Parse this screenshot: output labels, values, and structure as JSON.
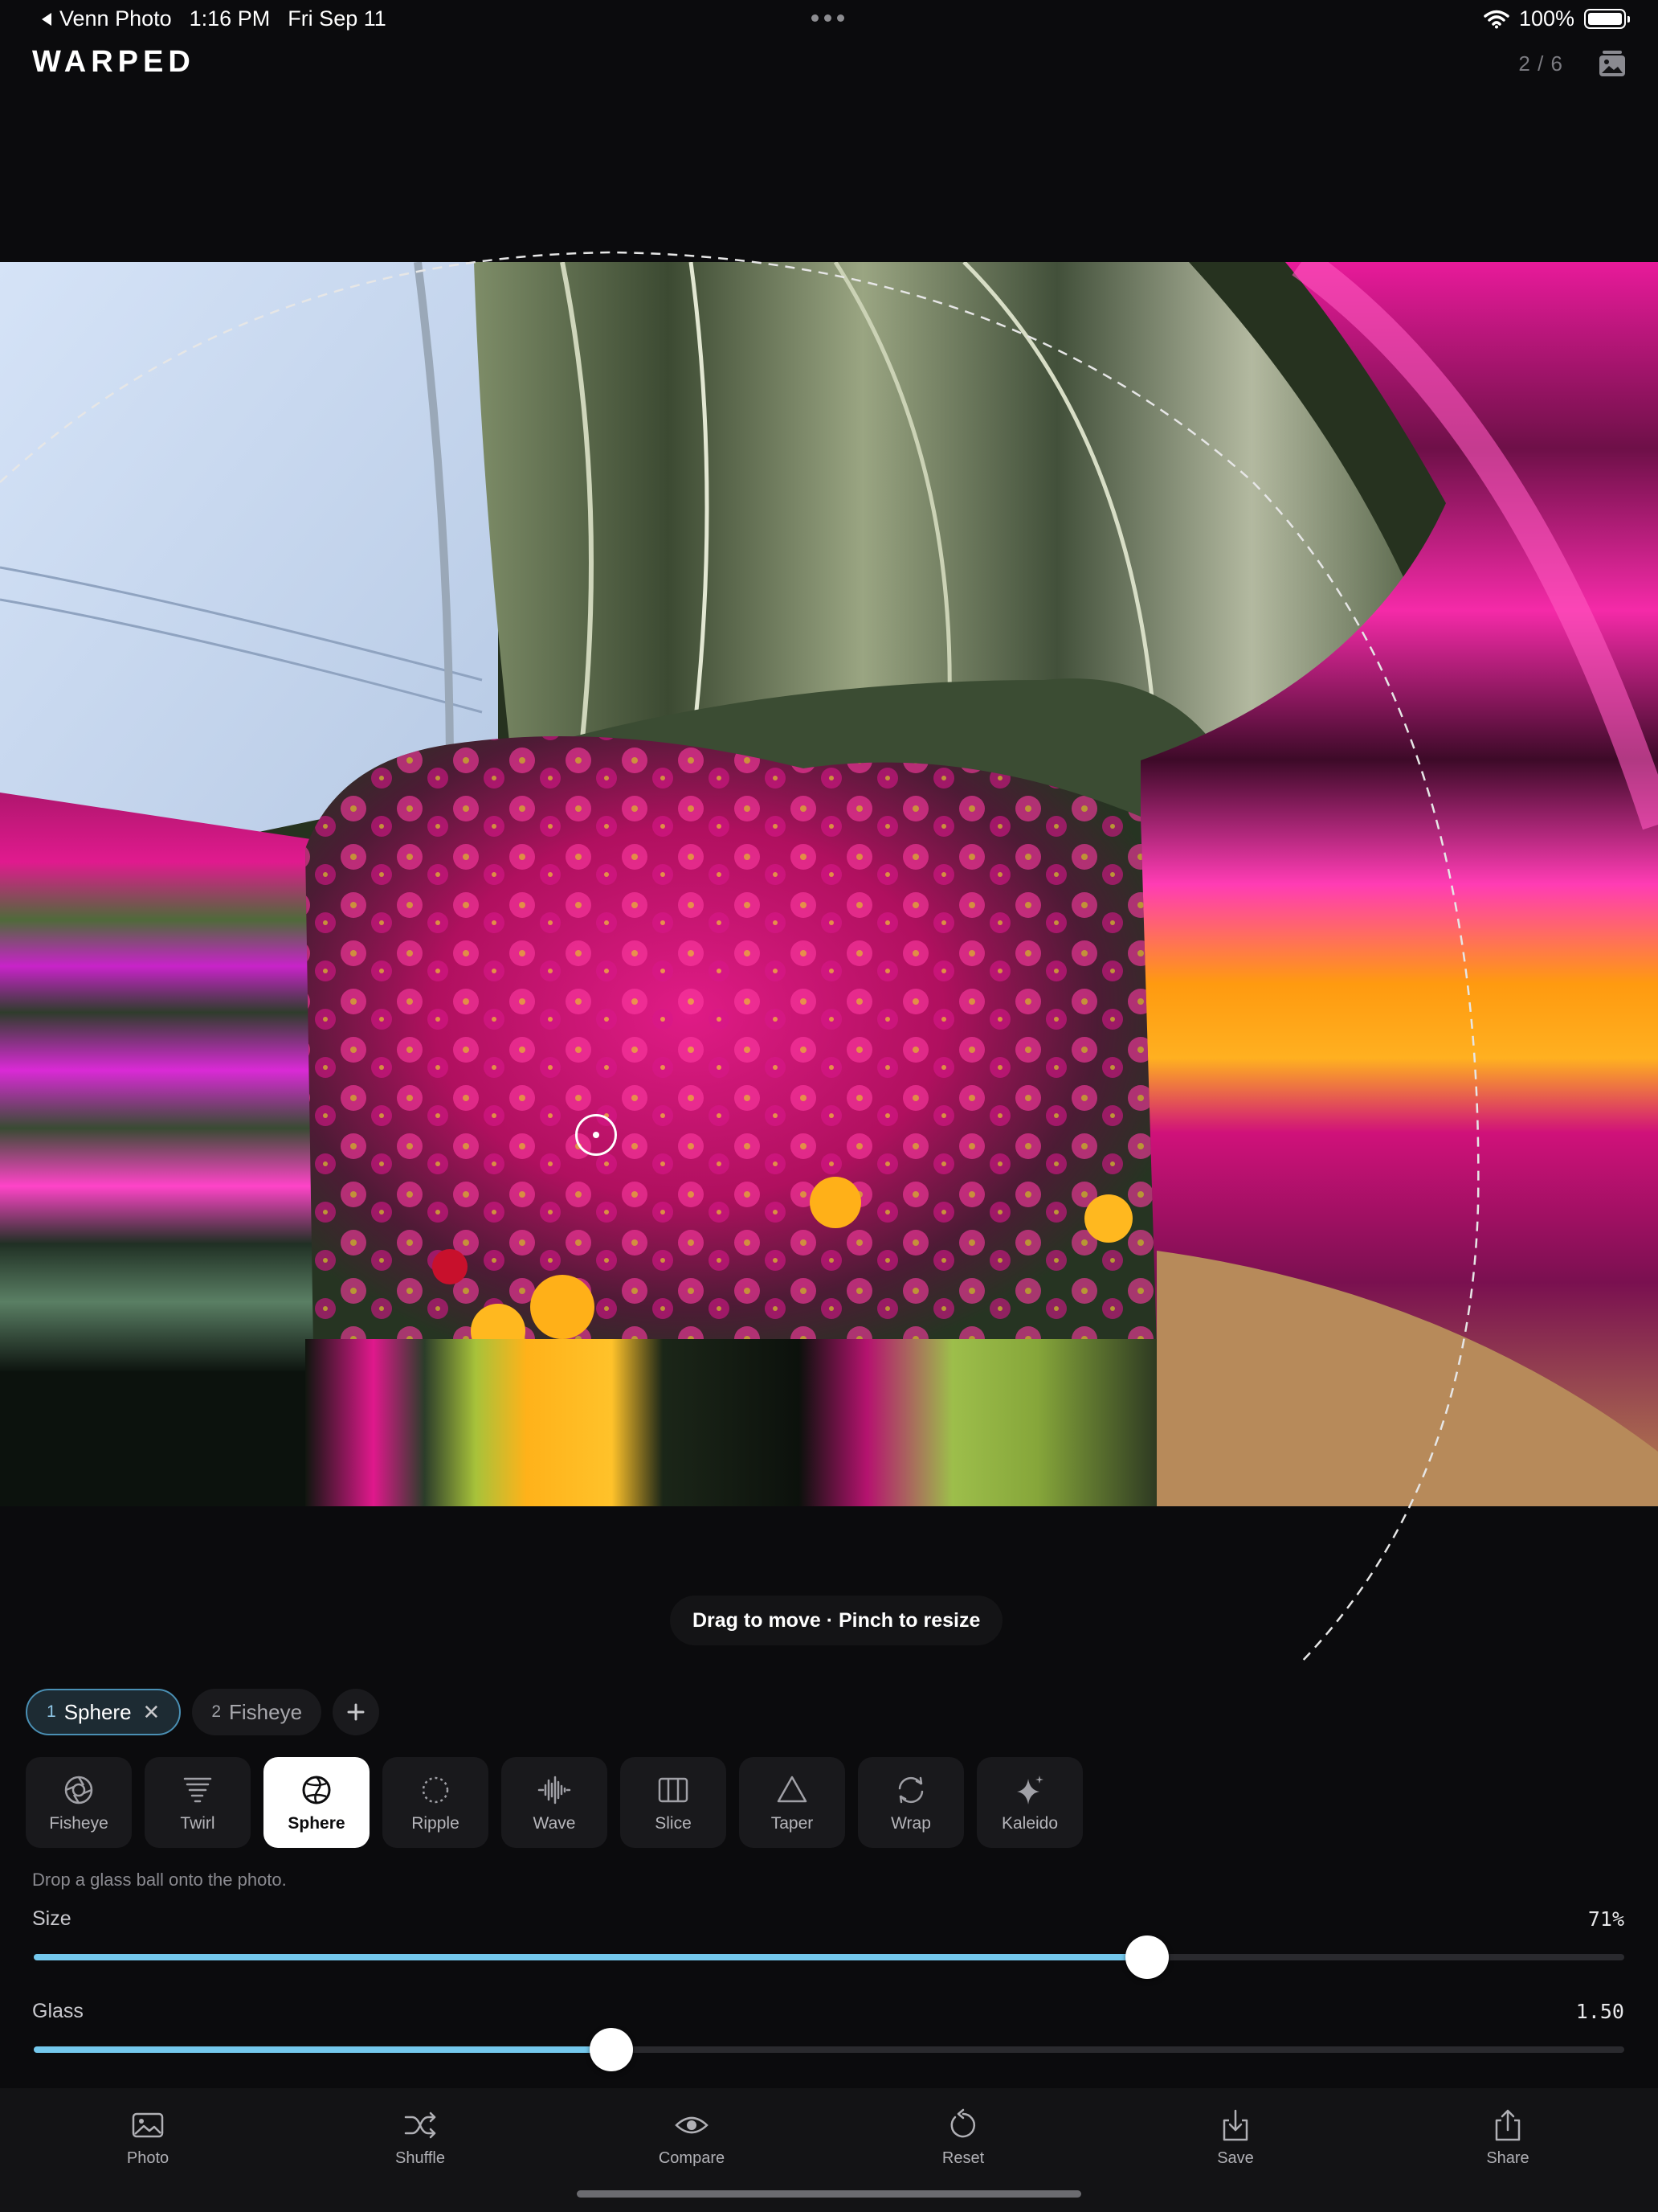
{
  "status_bar": {
    "back_app": "Venn Photo",
    "time": "1:16 PM",
    "date": "Fri Sep 11",
    "battery": "100%"
  },
  "header": {
    "title": "WARPED",
    "counter": "2 / 6"
  },
  "canvas": {
    "hint": "Drag to move · Pinch to resize"
  },
  "layers": [
    {
      "index": "1",
      "name": "Sphere",
      "active": true
    },
    {
      "index": "2",
      "name": "Fisheye",
      "active": false
    }
  ],
  "effects": [
    {
      "label": "Fisheye",
      "icon": "fisheye-icon"
    },
    {
      "label": "Twirl",
      "icon": "twirl-icon"
    },
    {
      "label": "Sphere",
      "icon": "sphere-icon",
      "selected": true
    },
    {
      "label": "Ripple",
      "icon": "ripple-icon"
    },
    {
      "label": "Wave",
      "icon": "wave-icon"
    },
    {
      "label": "Slice",
      "icon": "slice-icon"
    },
    {
      "label": "Taper",
      "icon": "taper-icon"
    },
    {
      "label": "Wrap",
      "icon": "wrap-icon"
    },
    {
      "label": "Kaleido",
      "icon": "kaleido-icon"
    }
  ],
  "effect_description": "Drop a glass ball onto the photo.",
  "sliders": {
    "size": {
      "label": "Size",
      "value": "71%",
      "fraction": 0.7
    },
    "glass": {
      "label": "Glass",
      "value": "1.50",
      "fraction": 0.363
    }
  },
  "toolbar": [
    {
      "label": "Photo",
      "icon": "photo-icon"
    },
    {
      "label": "Shuffle",
      "icon": "shuffle-icon"
    },
    {
      "label": "Compare",
      "icon": "eye-icon"
    },
    {
      "label": "Reset",
      "icon": "reset-icon"
    },
    {
      "label": "Save",
      "icon": "save-icon"
    },
    {
      "label": "Share",
      "icon": "share-icon"
    }
  ],
  "colors": {
    "accent": "#74c8ec",
    "background": "#0b0b0d",
    "active_chip_border": "#4a8fb3"
  }
}
